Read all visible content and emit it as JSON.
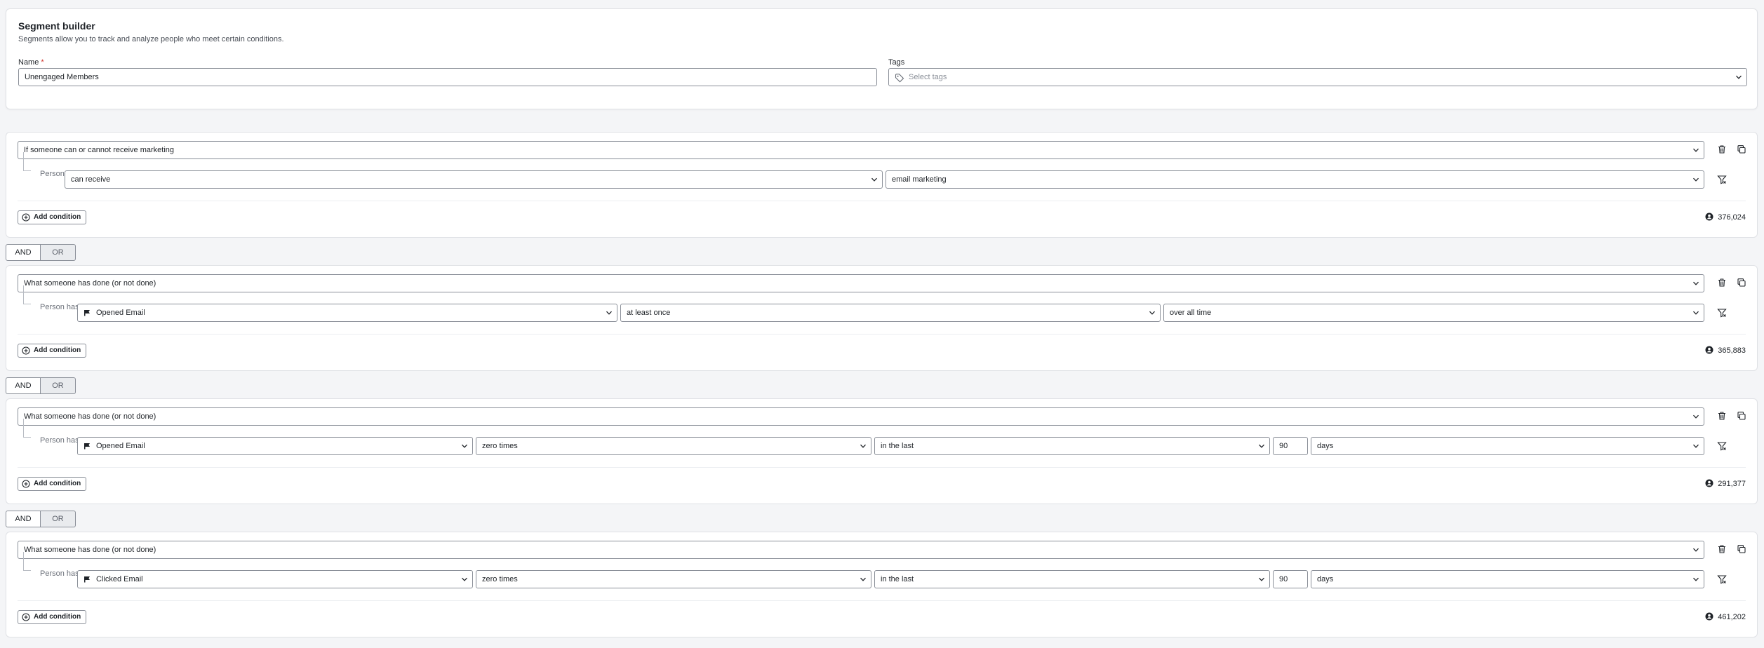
{
  "header": {
    "title": "Segment builder",
    "subtitle": "Segments allow you to track and analyze people who meet certain conditions.",
    "name_label": "Name",
    "required_mark": "*",
    "name_value": "Unengaged Members",
    "tags_label": "Tags",
    "tags_placeholder": "Select tags"
  },
  "connector": {
    "and": "AND",
    "or": "OR"
  },
  "add_condition_label": "Add condition",
  "blocks": [
    {
      "group": "If someone can or cannot receive marketing",
      "row_label": "Person",
      "fields": [
        "can receive",
        "email marketing"
      ],
      "count": "376,024"
    },
    {
      "group": "What someone has done (or not done)",
      "row_label": "Person has",
      "fields": [
        "Opened Email",
        "at least once",
        "over all time"
      ],
      "count": "365,883"
    },
    {
      "group": "What someone has done (or not done)",
      "row_label": "Person has",
      "fields": [
        "Opened Email",
        "zero times",
        "in the last",
        "90",
        "days"
      ],
      "count": "291,377"
    },
    {
      "group": "What someone has done (or not done)",
      "row_label": "Person has",
      "fields": [
        "Clicked Email",
        "zero times",
        "in the last",
        "90",
        "days"
      ],
      "count": "461,202"
    }
  ]
}
